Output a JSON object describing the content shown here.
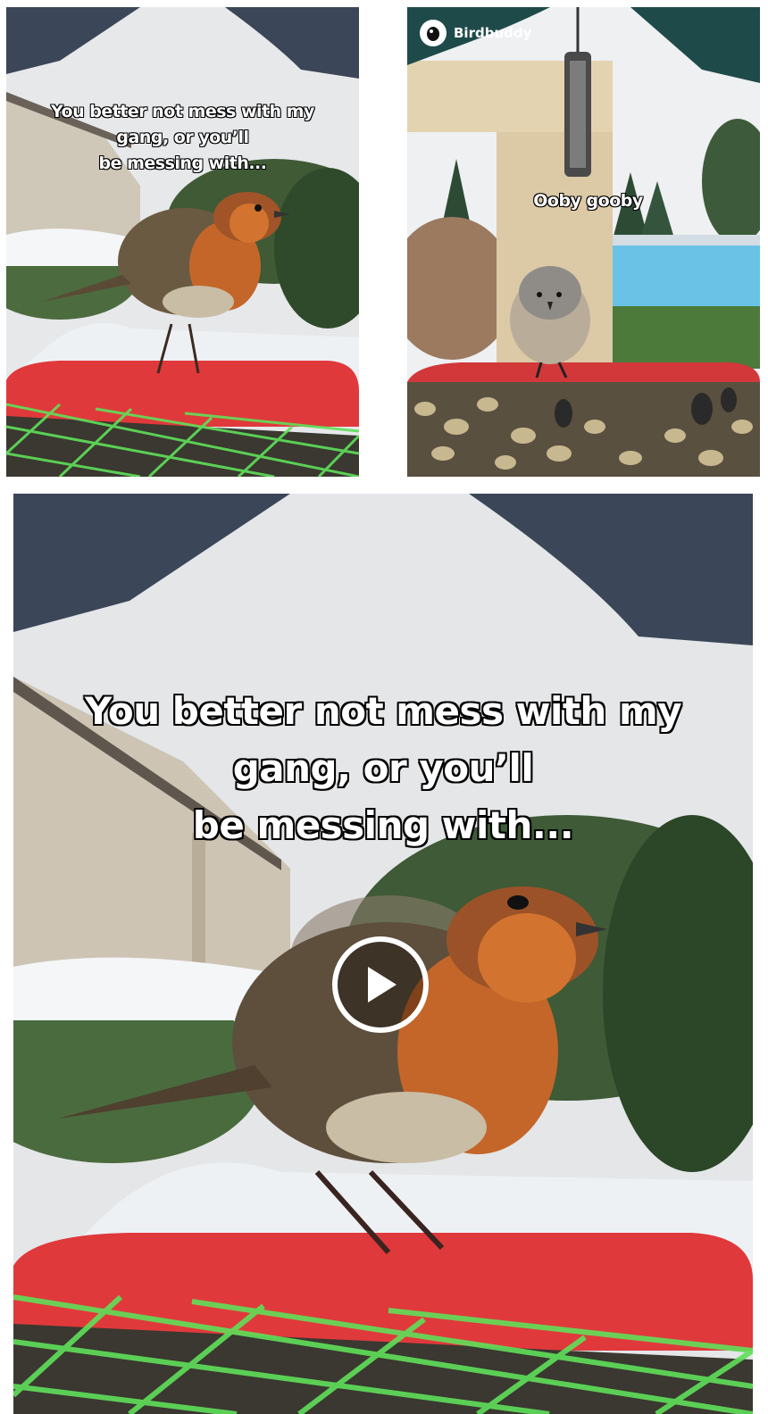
{
  "posts": [
    {
      "caption": "You better not mess with my\ngang, or you’ll\nbe messing with..."
    },
    {
      "brand": "Birdbuddy",
      "caption": "Ooby gooby"
    },
    {
      "caption": "You better not mess with my\ngang, or you’ll\nbe messing with..."
    }
  ],
  "icons": {
    "brand_logo": "bird-logo-icon",
    "play": "play-icon"
  },
  "colors": {
    "feeder_tray": "#e0393b",
    "feeder_roof": "#3b4658",
    "net": "#5fe05a",
    "caption_text": "#ffffff",
    "caption_outline": "#000000"
  }
}
